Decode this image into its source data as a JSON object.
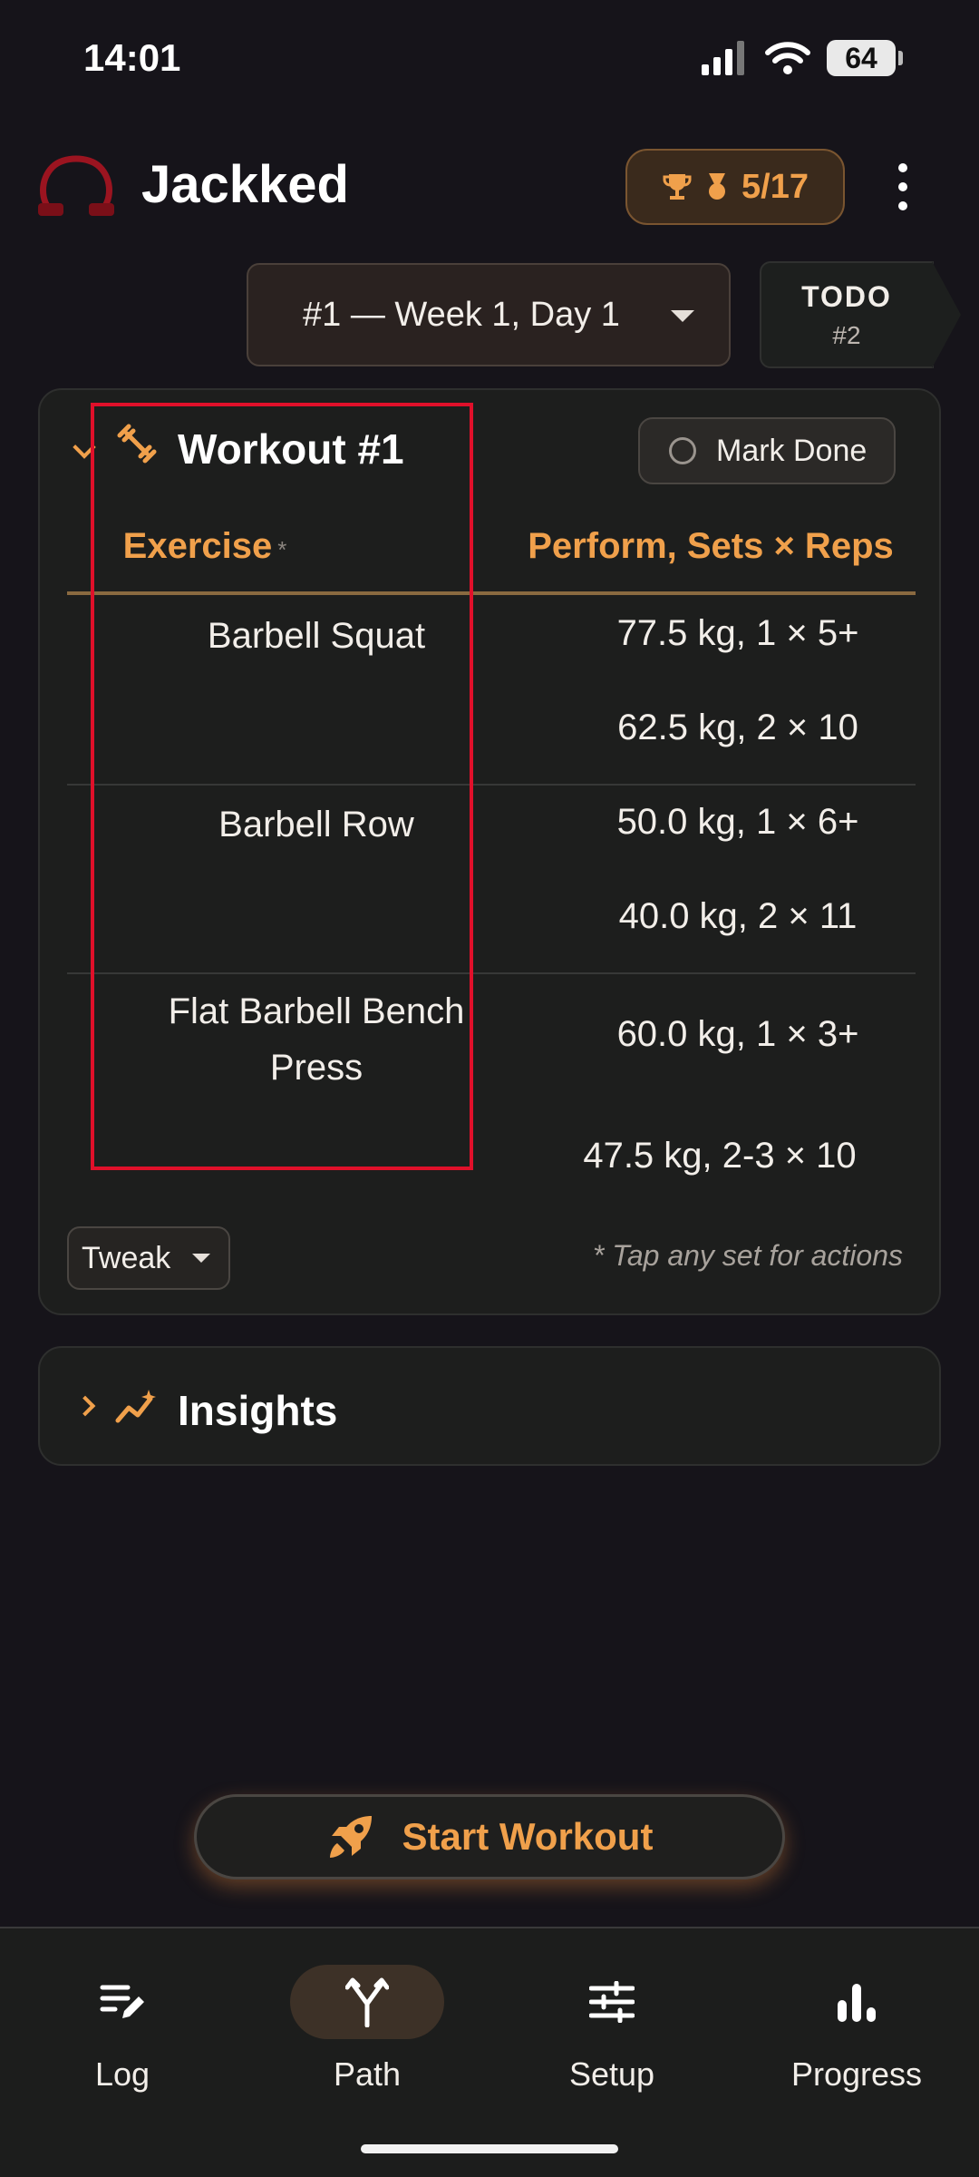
{
  "status_bar": {
    "time": "14:01",
    "battery": "64"
  },
  "header": {
    "app_title": "Jackked",
    "trophy_count": "5/17"
  },
  "day_selector": {
    "selected": "#1 — Week 1, Day 1"
  },
  "todo_tab": {
    "label": "TODO",
    "number": "#2"
  },
  "workout": {
    "title": "Workout #1",
    "mark_done_label": "Mark Done",
    "columns": {
      "exercise": "Exercise",
      "exercise_marker": "*",
      "perform": "Perform, Sets × Reps"
    },
    "exercises": [
      {
        "name": "Barbell Squat",
        "sets": [
          "77.5 kg, 1 × 5+",
          "62.5 kg, 2 × 10"
        ]
      },
      {
        "name": "Barbell Row",
        "sets": [
          "50.0 kg, 1 × 6+",
          "40.0 kg, 2 × 11"
        ]
      },
      {
        "name_line1": "Flat Barbell Bench",
        "name_line2": "Press",
        "sets": [
          "60.0 kg, 1 × 3+",
          "47.5 kg, 2-3 × 10"
        ]
      }
    ],
    "tweak_label": "Tweak",
    "hint": "* Tap any set for actions"
  },
  "insights": {
    "title": "Insights"
  },
  "start_button": {
    "label": "Start Workout"
  },
  "bottom_nav": {
    "items": [
      {
        "label": "Log",
        "icon": "log-edit-icon"
      },
      {
        "label": "Path",
        "icon": "path-fork-icon",
        "active": true
      },
      {
        "label": "Setup",
        "icon": "sliders-icon"
      },
      {
        "label": "Progress",
        "icon": "bar-chart-icon"
      }
    ]
  },
  "colors": {
    "accent": "#f0a04b",
    "background": "#16141a",
    "card": "#1d1e1d",
    "highlight": "#e0102a"
  }
}
